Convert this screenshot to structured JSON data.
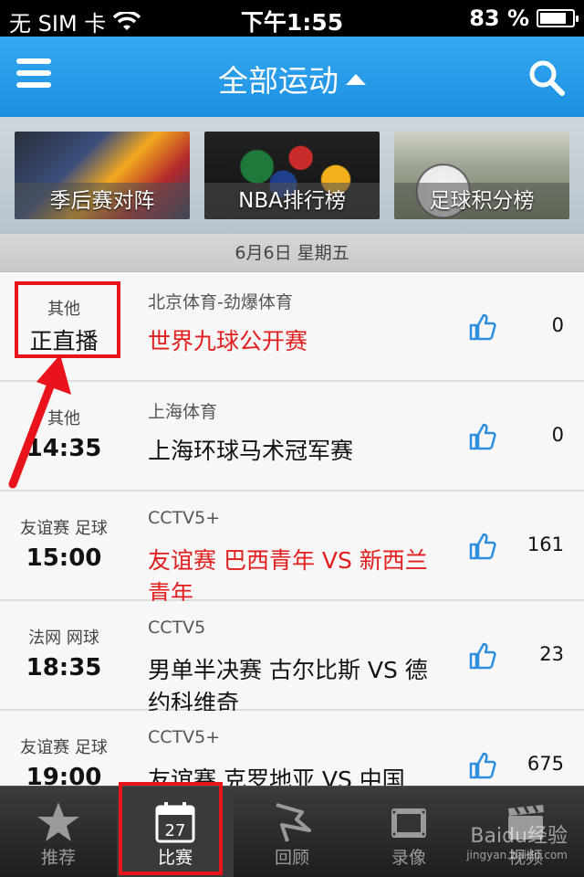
{
  "status": {
    "carrier": "无 SIM 卡",
    "time": "下午1:55",
    "battery_percent_text": "83 %",
    "battery_level": 0.83
  },
  "nav": {
    "title": "全部运动",
    "menu_icon": "hamburger-menu-icon",
    "search_icon": "search-icon"
  },
  "banners": [
    {
      "label": "季后赛对阵"
    },
    {
      "label": "NBA排行榜"
    },
    {
      "label": "足球积分榜"
    }
  ],
  "date": "6月6日  星期五",
  "matches": [
    {
      "category": "其他",
      "time": "正直播",
      "channel": "北京体育-劲爆体育",
      "title": "世界九球公开赛",
      "likes": "0"
    },
    {
      "category": "其他",
      "time": "14:35",
      "channel": "上海体育",
      "title": "上海环球马术冠军赛",
      "likes": "0"
    },
    {
      "category": "友谊赛 足球",
      "time": "15:00",
      "channel": "CCTV5+",
      "title": "友谊赛 巴西青年 VS 新西兰青年",
      "likes": "161"
    },
    {
      "category": "法网 网球",
      "time": "18:35",
      "channel": "CCTV5",
      "title": "男单半决赛 古尔比斯 VS 德约科维奇",
      "likes": "23"
    },
    {
      "category": "友谊赛 足球",
      "time": "19:00",
      "channel": "CCTV5+",
      "title": "友谊赛 克罗地亚 VS 中国",
      "likes": "675"
    }
  ],
  "tabs": [
    {
      "label": "推荐",
      "icon": "star-icon"
    },
    {
      "label": "比赛",
      "icon": "calendar-icon",
      "badge": "27"
    },
    {
      "label": "回顾",
      "icon": "flag-icon"
    },
    {
      "label": "录像",
      "icon": "film-icon"
    },
    {
      "label": "视频",
      "icon": "clapperboard-icon"
    }
  ],
  "watermark": {
    "brand": "Baidu经验",
    "url": "jingyan.baidu.com"
  },
  "colors": {
    "accent": "#1b8fe0",
    "live_red": "#e21d1d",
    "highlight": "#e8131b"
  }
}
